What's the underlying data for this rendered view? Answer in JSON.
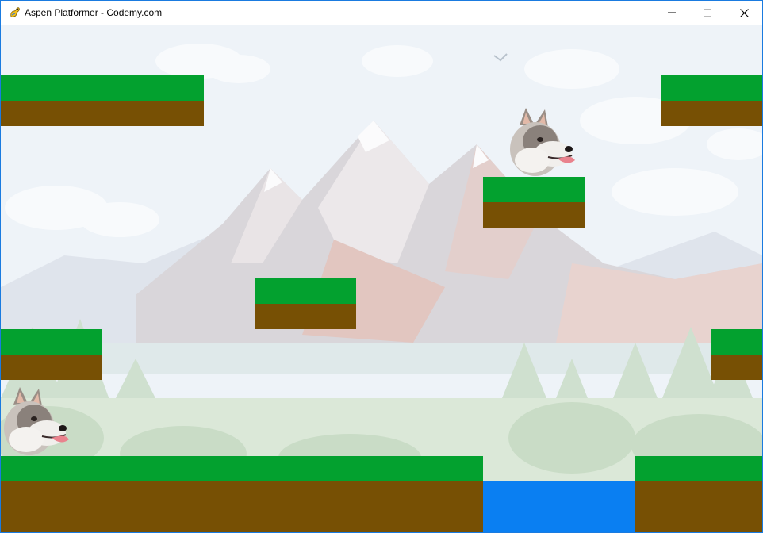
{
  "window": {
    "title": "Aspen Platformer - Codemy.com",
    "icon": "pygame-snake-icon",
    "controls": [
      "minimize-icon",
      "maximize-icon",
      "close-icon"
    ]
  },
  "game": {
    "background": "pixel-art mountain landscape with clouds and pine forest (faded)",
    "colors": {
      "grass": "#03a12f",
      "dirt": "#775004",
      "water": "#0a7ff2",
      "sky": "#eef3f8"
    },
    "platforms": [
      "upper-left",
      "upper-right",
      "center-high",
      "center-mid",
      "left-mid",
      "right-mid",
      "ground-left",
      "ground-right"
    ],
    "hazards": [
      "water-pit"
    ],
    "sprites": [
      {
        "name": "player-husky",
        "icon": "husky-head-icon"
      },
      {
        "name": "enemy-husky",
        "icon": "husky-head-icon"
      }
    ]
  }
}
